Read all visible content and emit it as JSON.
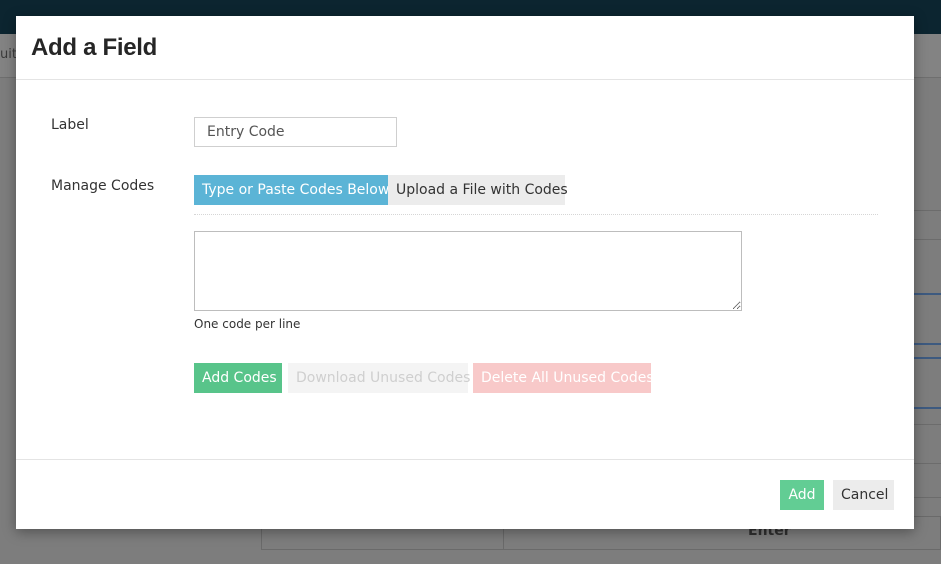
{
  "background": {
    "breadcrumb_fragment": "uit",
    "table_cell_text": "Enter"
  },
  "modal": {
    "title": "Add a Field",
    "label_field": {
      "label": "Label",
      "value": "Entry Code"
    },
    "manage_codes": {
      "label": "Manage Codes",
      "tabs": [
        {
          "label": "Type or Paste Codes Below",
          "active": true
        },
        {
          "label": "Upload a File with Codes",
          "active": false
        }
      ],
      "textarea_value": "",
      "hint": "One code per line",
      "buttons": {
        "add_codes": "Add Codes",
        "download_unused": "Download Unused Codes",
        "delete_unused": "Delete All Unused Codes"
      }
    },
    "footer": {
      "add": "Add",
      "cancel": "Cancel"
    }
  },
  "colors": {
    "active_tab": "#5bb4d6",
    "success": "#58c48a",
    "danger_disabled": "#f8c9c9",
    "top_bar": "#0c2530"
  }
}
